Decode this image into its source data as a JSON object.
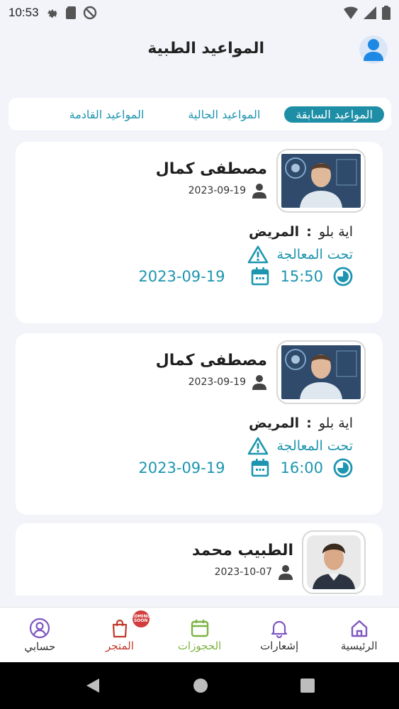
{
  "status_bar": {
    "time": "10:53"
  },
  "header": {
    "title": "المواعيد الطبية"
  },
  "tabs": [
    {
      "label": "المواعيد السابقة",
      "active": true
    },
    {
      "label": "المواعيد الحالية",
      "active": false
    },
    {
      "label": "المواعيد القادمة",
      "active": false
    }
  ],
  "appointments": [
    {
      "doctor": "مصطفى كمال",
      "date": "2023-09-19",
      "patient_label": "المريض",
      "patient_colon": ":",
      "patient_name": "اية بلو",
      "status": "تحت المعالجة",
      "time": "15:50",
      "appt_date": "2023-09-19"
    },
    {
      "doctor": "مصطفى كمال",
      "date": "2023-09-19",
      "patient_label": "المريض",
      "patient_colon": ":",
      "patient_name": "اية بلو",
      "status": "تحت المعالجة",
      "time": "16:00",
      "appt_date": "2023-09-19"
    },
    {
      "doctor": "الطبيب محمد",
      "date": "2023-10-07"
    }
  ],
  "bottom_nav": {
    "home": "الرئيسية",
    "notifications": "إشعارات",
    "bookings": "الحجوزات",
    "store": "المتجر",
    "store_badge": "COMING SOON",
    "account": "حسابي"
  },
  "colors": {
    "accent": "#1d8ea6",
    "bookings": "#7cb342",
    "store": "#c0392b"
  }
}
